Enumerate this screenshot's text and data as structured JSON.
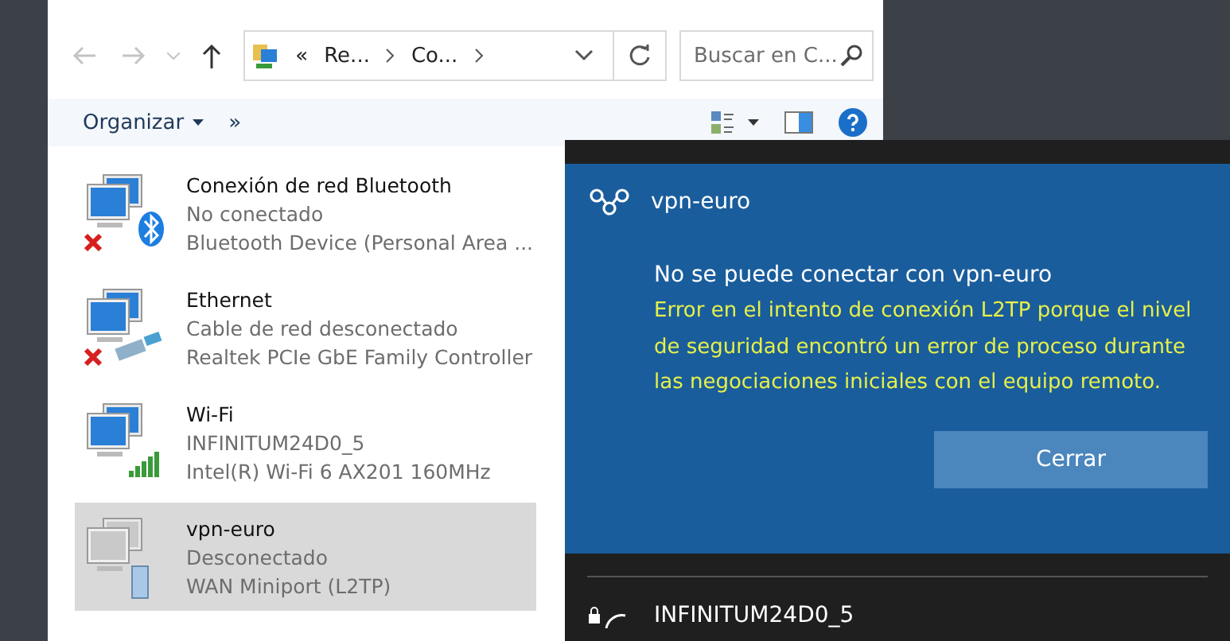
{
  "address": {
    "overflow": "«",
    "crumbs": [
      "Re...",
      "Co..."
    ]
  },
  "search": {
    "placeholder": "Buscar en C..."
  },
  "toolbar": {
    "organize": "Organizar",
    "more": "»"
  },
  "connections": [
    {
      "name": "Conexión de red Bluetooth",
      "status": "No conectado",
      "device": "Bluetooth Device (Personal Area ...",
      "kind": "bluetooth",
      "disconnected": true,
      "selected": false
    },
    {
      "name": "Ethernet",
      "status": "Cable de red desconectado",
      "device": "Realtek PCIe GbE Family Controller",
      "kind": "ethernet",
      "disconnected": true,
      "selected": false
    },
    {
      "name": "Wi-Fi",
      "status": "INFINITUM24D0_5",
      "device": "Intel(R) Wi-Fi 6 AX201 160MHz",
      "kind": "wifi",
      "disconnected": false,
      "selected": false
    },
    {
      "name": "vpn-euro",
      "status": "Desconectado",
      "device": "WAN Miniport (L2TP)",
      "kind": "vpn",
      "disconnected": false,
      "selected": true
    }
  ],
  "flyout": {
    "vpn_name": "vpn-euro",
    "heading": "No se puede conectar con vpn-euro",
    "error": "Error en el intento de conexión L2TP porque el nivel de seguridad encontró un error de proceso durante las negociaciones iniciales con el equipo remoto.",
    "close_button": "Cerrar",
    "network": "INFINITUM24D0_5"
  }
}
